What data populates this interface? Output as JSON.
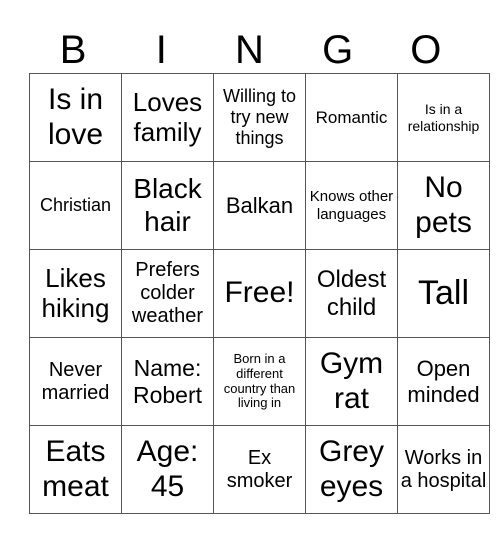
{
  "header": [
    "B",
    "I",
    "N",
    "G",
    "O"
  ],
  "cells": [
    [
      "Is in love",
      "Loves family",
      "Willing to try new things",
      "Romantic",
      "Is in a relationship"
    ],
    [
      "Christian",
      "Black hair",
      "Balkan",
      "Knows other languages",
      "No pets"
    ],
    [
      "Likes hiking",
      "Prefers colder weather",
      "Free!",
      "Oldest child",
      "Tall"
    ],
    [
      "Never married",
      "Name: Robert",
      "Born in a different country than living in",
      "Gym rat",
      "Open minded"
    ],
    [
      "Eats meat",
      "Age: 45",
      "Ex smoker",
      "Grey eyes",
      "Works in a hospital"
    ]
  ]
}
